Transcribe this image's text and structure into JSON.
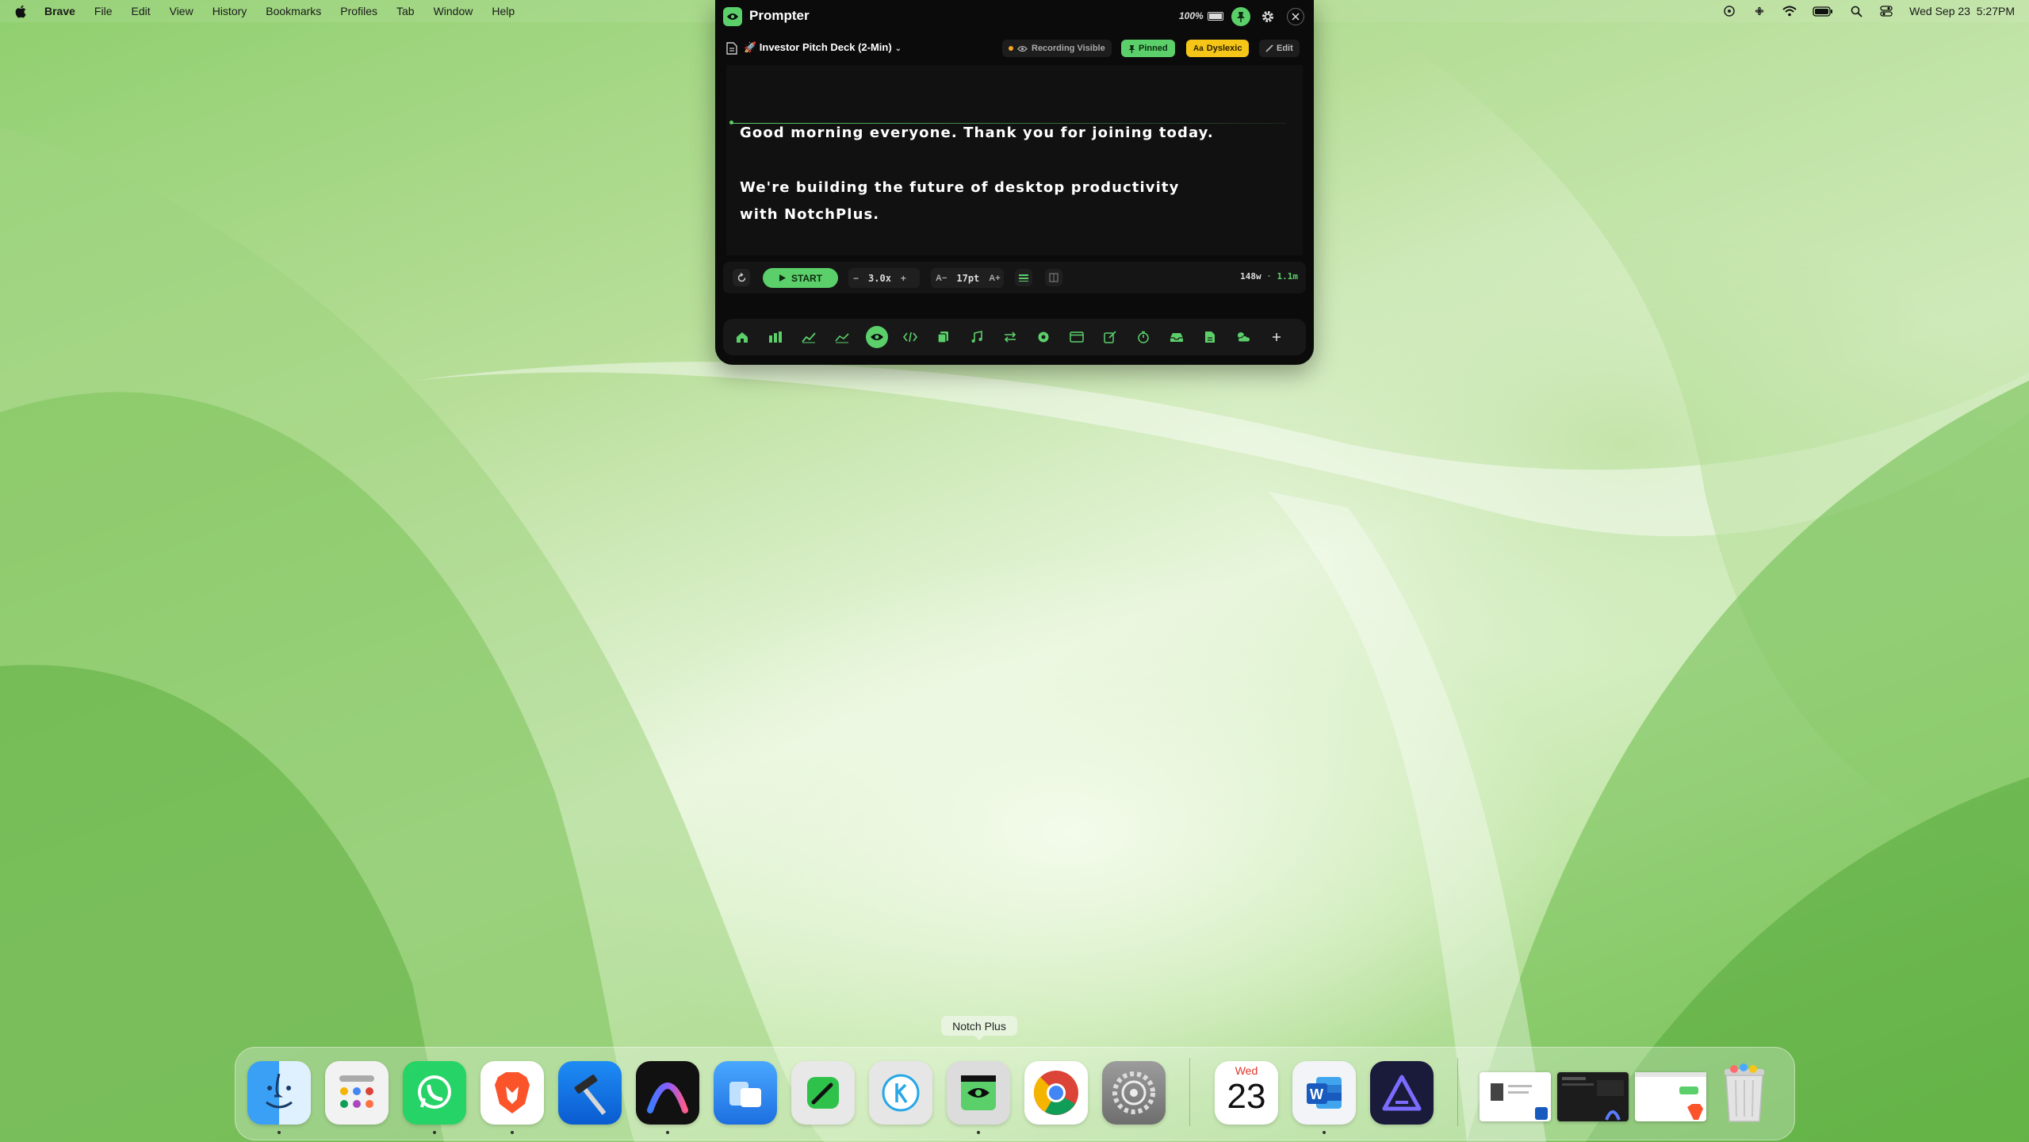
{
  "menubar": {
    "app_name": "Brave",
    "items": [
      "File",
      "Edit",
      "View",
      "History",
      "Bookmarks",
      "Profiles",
      "Tab",
      "Window",
      "Help"
    ],
    "datetime": "Wed Sep 23  5:27PM"
  },
  "prompter": {
    "title": "Prompter",
    "battery": "100%",
    "document": "🚀 Investor Pitch Deck (2-Min)",
    "recording": "Recording Visible",
    "pinned": "Pinned",
    "dyslexic": "Dyslexic",
    "edit": "Edit",
    "script": [
      "Good morning everyone. Thank you for joining today.",
      "We're building the future of desktop productivity",
      "with NotchPlus."
    ],
    "controls": {
      "start": "START",
      "minus": "−",
      "speed": "3.0x",
      "plus": "+",
      "font_dec": "A−",
      "font_size": "17pt",
      "font_inc": "A+",
      "words": "148w",
      "duration": "1.1m"
    },
    "toolbar": [
      "home-icon",
      "bar-chart-icon",
      "line-chart-icon",
      "area-chart-icon",
      "eye-icon",
      "code-icon",
      "copy-icon",
      "music-icon",
      "swap-icon",
      "record-icon",
      "window-icon",
      "edit-note-icon",
      "timer-icon",
      "inbox-icon",
      "document-icon",
      "weather-icon",
      "plus-icon"
    ]
  },
  "dock": {
    "tooltip": "Notch Plus",
    "apps": [
      "Finder",
      "Launchpad",
      "WhatsApp",
      "Brave Browser",
      "Xcode",
      "Arc",
      "Mirror",
      "Jot",
      "Klack",
      "Notch Plus",
      "Google Chrome",
      "System Settings",
      "Calendar",
      "Microsoft Word",
      "Affinity"
    ],
    "calendar_weekday": "Wed",
    "calendar_day": "23"
  },
  "colors": {
    "accent_green": "#5bcf6a",
    "dyslexic_yellow": "#f5c518"
  }
}
